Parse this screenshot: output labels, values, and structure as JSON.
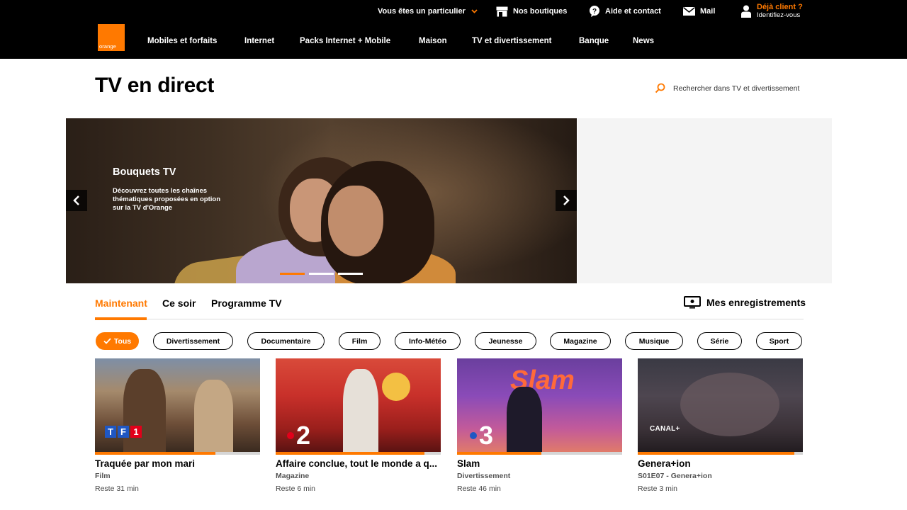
{
  "header": {
    "util": {
      "particulier": "Vous êtes un particulier",
      "boutiques": "Nos boutiques",
      "aide": "Aide et contact",
      "mail": "Mail",
      "client_title": "Déjà client ?",
      "client_sub": "Identifiez-vous"
    },
    "logo_text": "orange",
    "nav": [
      "Mobiles et forfaits",
      "Internet",
      "Packs Internet + Mobile",
      "Maison",
      "TV et divertissement",
      "Banque",
      "News"
    ]
  },
  "page": {
    "title": "TV en direct",
    "search_label": "Rechercher dans TV et divertissement"
  },
  "hero": {
    "title": "Bouquets TV",
    "description": "Découvrez toutes les chaînes thématiques proposées en option sur la TV d'Orange",
    "slide_count": 3,
    "active_slide": 0
  },
  "tabs": {
    "items": [
      "Maintenant",
      "Ce soir",
      "Programme TV"
    ],
    "active": 0,
    "recordings": "Mes enregistrements"
  },
  "filters": {
    "items": [
      "Tous",
      "Divertissement",
      "Documentaire",
      "Film",
      "Info-Météo",
      "Jeunesse",
      "Magazine",
      "Musique",
      "Série",
      "Sport"
    ],
    "active": 0
  },
  "programs": [
    {
      "channel": "TF1",
      "title": "Traquée par mon mari",
      "genre": "Film",
      "remaining": "Reste 31 min",
      "progress": 0.73
    },
    {
      "channel": "2",
      "title": "Affaire conclue, tout le monde a q...",
      "genre": "Magazine",
      "remaining": "Reste 6 min",
      "progress": 0.9
    },
    {
      "channel": "3",
      "title": "Slam",
      "genre": "Divertissement",
      "remaining": "Reste 46 min",
      "progress": 0.51
    },
    {
      "channel": "CANAL+",
      "title": "Genera+ion",
      "genre": "S01E07 - Genera+ion",
      "remaining": "Reste 3 min",
      "progress": 0.95
    }
  ],
  "colors": {
    "accent": "#ff7900",
    "header_bg": "#000000"
  }
}
